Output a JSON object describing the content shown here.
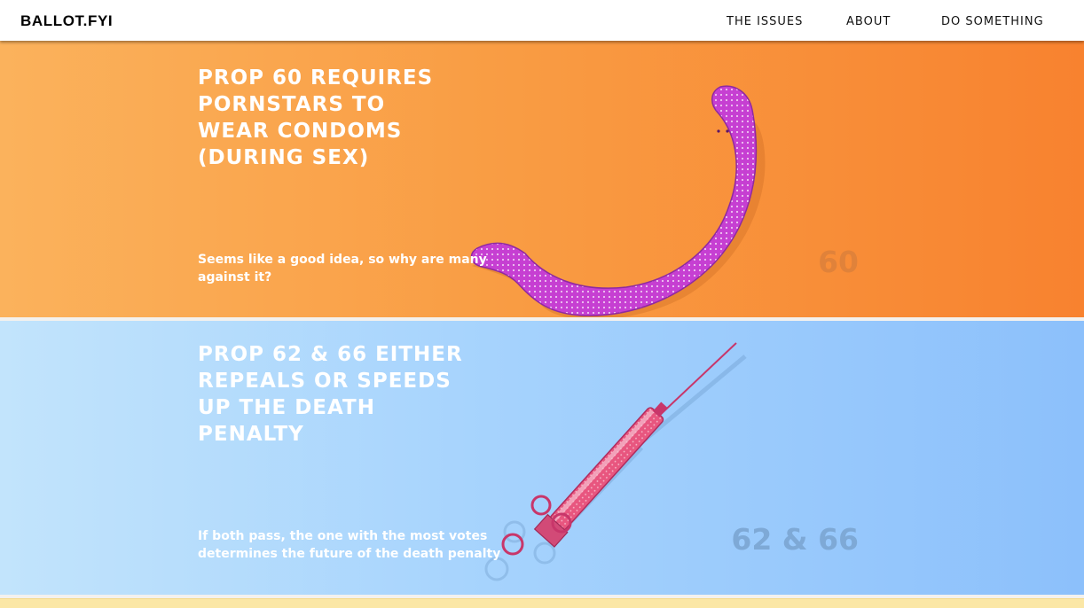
{
  "header": {
    "logo": "BALLOT.FYI",
    "nav": [
      {
        "label": "THE ISSUES"
      },
      {
        "label": "ABOUT"
      },
      {
        "label": "DO SOMETHING"
      }
    ]
  },
  "props": [
    {
      "title": "PROP 60 REQUIRES PORNSTARS TO WEAR CONDOMS (DURING SEX)",
      "subtitle": "Seems like a good idea, so why are many against it?",
      "number": "60",
      "illustration": "banana-icon",
      "colors": {
        "bg_start": "#fbb25c",
        "bg_end": "#f8822f",
        "number": "#e0823a",
        "illustration": "#c63fd2"
      }
    },
    {
      "title": "PROP 62 & 66 EITHER REPEALS OR SPEEDS UP THE DEATH PENALTY",
      "subtitle": "If both pass, the one with the most votes determines the future of the death penalty",
      "number": "62 & 66",
      "illustration": "syringe-icon",
      "colors": {
        "bg_start": "#c2e4fc",
        "bg_end": "#8cc0fb",
        "number": "#7ea9d6",
        "illustration": "#d0407a"
      }
    }
  ]
}
